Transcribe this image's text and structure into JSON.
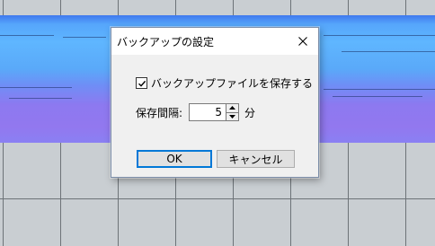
{
  "dialog": {
    "title": "バックアップの設定",
    "checkbox_label": "バックアップファイルを保存する",
    "checkbox_checked": true,
    "interval_label": "保存間隔:",
    "interval_value": "5",
    "interval_unit": "分",
    "ok_label": "OK",
    "cancel_label": "キャンセル"
  },
  "icons": {
    "close": "close-icon",
    "check": "checkmark-icon",
    "spin_up": "chevron-up-icon",
    "spin_down": "chevron-down-icon"
  },
  "colors": {
    "accent": "#0078d7",
    "dialog_bg": "#f0f0f0",
    "grid_bg": "#c9ced2"
  }
}
